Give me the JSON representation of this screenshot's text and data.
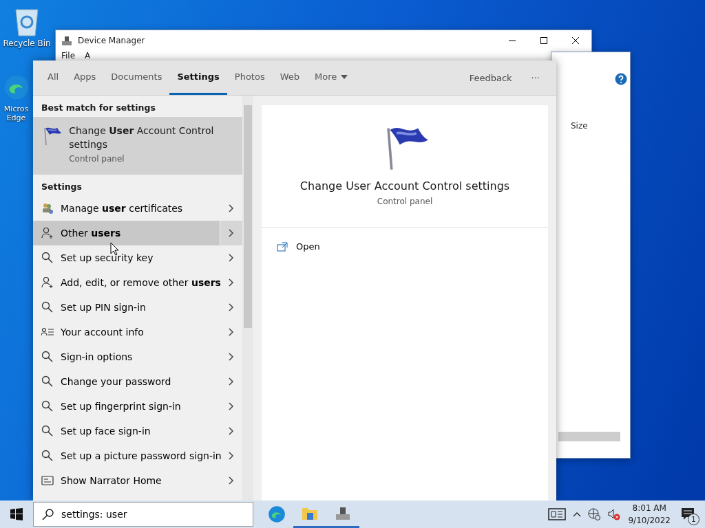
{
  "desktop_icons": [
    {
      "kind": "recycle",
      "label": "Recycle Bin"
    },
    {
      "kind": "edge",
      "label": "Micros Edge"
    }
  ],
  "device_manager": {
    "title": "Device Manager",
    "menu": [
      "File",
      "A"
    ]
  },
  "explorer_window": {
    "column": "Size"
  },
  "search_panel": {
    "tabs": [
      {
        "label": "All",
        "selected": false
      },
      {
        "label": "Apps",
        "selected": false
      },
      {
        "label": "Documents",
        "selected": false
      },
      {
        "label": "Settings",
        "selected": true
      },
      {
        "label": "Photos",
        "selected": false
      },
      {
        "label": "Web",
        "selected": false
      },
      {
        "label": "More",
        "selected": false
      }
    ],
    "feedback": "Feedback",
    "more_options": "···",
    "best_match": {
      "header": "Best match for settings",
      "title": "Change **User** Account Control settings",
      "subtitle": "Control panel",
      "selected": true
    },
    "section": "Settings",
    "results": [
      {
        "kind": "certificate",
        "label": "Manage **user** certificates",
        "selected": false
      },
      {
        "kind": "person",
        "label": "Other **users**",
        "selected": true
      },
      {
        "kind": "key",
        "label": "Set up security key",
        "selected": false
      },
      {
        "kind": "person",
        "label": "Add, edit, or remove other **users**",
        "selected": false
      },
      {
        "kind": "key",
        "label": "Set up PIN sign-in",
        "selected": false
      },
      {
        "kind": "list",
        "label": "Your account info",
        "selected": false
      },
      {
        "kind": "key",
        "label": "Sign-in options",
        "selected": false
      },
      {
        "kind": "key",
        "label": "Change your password",
        "selected": false
      },
      {
        "kind": "key",
        "label": "Set up fingerprint sign-in",
        "selected": false
      },
      {
        "kind": "key",
        "label": "Set up face sign-in",
        "selected": false
      },
      {
        "kind": "key",
        "label": "Set up a picture password sign-in",
        "selected": false
      },
      {
        "kind": "narrator",
        "label": "Show Narrator Home",
        "selected": false
      }
    ],
    "detail": {
      "title": "Change User Account Control settings",
      "subtitle": "Control panel",
      "actions": [
        {
          "label": "Open"
        }
      ]
    }
  },
  "taskbar": {
    "search_value": "settings: user",
    "time": "8:01 AM",
    "date": "9/10/2022",
    "notification_count": "1"
  }
}
